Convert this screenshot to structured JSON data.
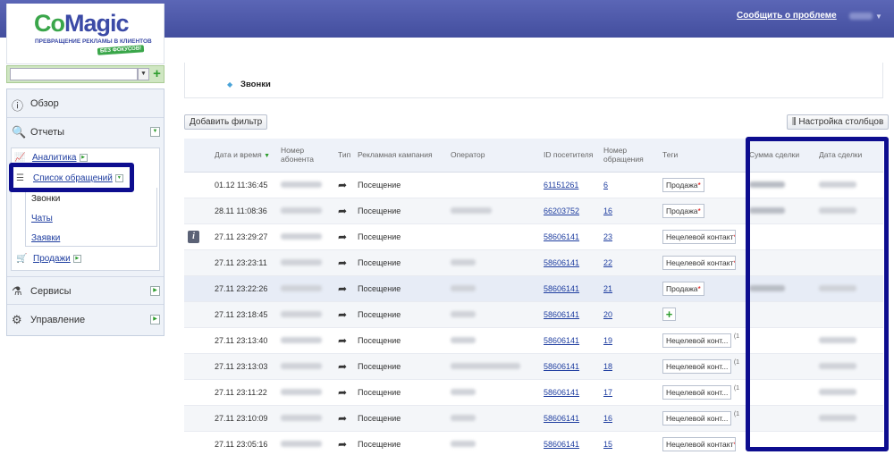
{
  "header": {
    "report_link": "Сообщить о проблеме"
  },
  "logo": {
    "word_a": "Co",
    "word_b": "Magic",
    "tagline": "ПРЕВРАЩЕНИЕ РЕКЛАМЫ В КЛИЕНТОВ",
    "badge": "БЕЗ ФОКУСОВ!"
  },
  "search": {
    "value": ""
  },
  "sidebar": {
    "overview": "Обзор",
    "reports": "Отчеты",
    "analytics": "Аналитика",
    "calls_list": "Список обращений",
    "calls": "Звонки",
    "chats": "Чаты",
    "requests": "Заявки",
    "sales": "Продажи",
    "services": "Сервисы",
    "management": "Управление"
  },
  "breadcrumb": {
    "current": "Звонки"
  },
  "toolbar": {
    "add_filter": "Добавить фильтр",
    "columns": "Настройка столбцов"
  },
  "table": {
    "headers": {
      "datetime": "Дата и время",
      "number": "Номер абонента",
      "type": "Тип",
      "campaign": "Рекламная кампания",
      "operator": "Оператор",
      "visitor": "ID посетителя",
      "request_no": "Номер обращения",
      "tags": "Теги",
      "deal_sum": "Сумма сделки",
      "deal_date": "Дата сделки"
    },
    "rows": [
      {
        "datetime": "01.12 11:36:45",
        "campaign": "Посещение",
        "visitor": "61151261",
        "request_no": "6",
        "tag": "Продажа",
        "tag_star": true,
        "tag_extra": "",
        "operator": false,
        "deal_sum": true,
        "deal_date": true,
        "info": false,
        "selected": false
      },
      {
        "datetime": "28.11 11:08:36",
        "campaign": "Посещение",
        "visitor": "66203752",
        "request_no": "16",
        "tag": "Продажа",
        "tag_star": true,
        "tag_extra": "",
        "operator": true,
        "deal_sum": true,
        "deal_date": true,
        "info": false,
        "selected": false
      },
      {
        "datetime": "27.11 23:29:27",
        "campaign": "Посещение",
        "visitor": "58606141",
        "request_no": "23",
        "tag": "Нецелевой контакт",
        "tag_star": true,
        "tag_extra": "",
        "operator": false,
        "deal_sum": false,
        "deal_date": false,
        "info": true,
        "selected": false
      },
      {
        "datetime": "27.11 23:23:11",
        "campaign": "Посещение",
        "visitor": "58606141",
        "request_no": "22",
        "tag": "Нецелевой контакт",
        "tag_star": true,
        "tag_extra": "",
        "operator": true,
        "deal_sum": false,
        "deal_date": false,
        "info": false,
        "selected": false
      },
      {
        "datetime": "27.11 23:22:26",
        "campaign": "Посещение",
        "visitor": "58606141",
        "request_no": "21",
        "tag": "Продажа",
        "tag_star": true,
        "tag_extra": "",
        "operator": true,
        "deal_sum": true,
        "deal_date": true,
        "info": false,
        "selected": true
      },
      {
        "datetime": "27.11 23:18:45",
        "campaign": "Посещение",
        "visitor": "58606141",
        "request_no": "20",
        "tag": "",
        "tag_star": false,
        "tag_extra": "",
        "operator": true,
        "deal_sum": false,
        "deal_date": false,
        "info": false,
        "selected": false
      },
      {
        "datetime": "27.11 23:13:40",
        "campaign": "Посещение",
        "visitor": "58606141",
        "request_no": "19",
        "tag": "Нецелевой конт...",
        "tag_star": false,
        "tag_extra": "(1",
        "operator": true,
        "deal_sum": false,
        "deal_date": true,
        "info": false,
        "selected": false
      },
      {
        "datetime": "27.11 23:13:03",
        "campaign": "Посещение",
        "visitor": "58606141",
        "request_no": "18",
        "tag": "Нецелевой конт...",
        "tag_star": false,
        "tag_extra": "(1",
        "operator": true,
        "deal_sum": false,
        "deal_date": true,
        "info": false,
        "selected": false
      },
      {
        "datetime": "27.11 23:11:22",
        "campaign": "Посещение",
        "visitor": "58606141",
        "request_no": "17",
        "tag": "Нецелевой конт...",
        "tag_star": false,
        "tag_extra": "(1",
        "operator": true,
        "deal_sum": false,
        "deal_date": true,
        "info": false,
        "selected": false
      },
      {
        "datetime": "27.11 23:10:09",
        "campaign": "Посещение",
        "visitor": "58606141",
        "request_no": "16",
        "tag": "Нецелевой конт...",
        "tag_star": false,
        "tag_extra": "(1",
        "operator": true,
        "deal_sum": false,
        "deal_date": true,
        "info": false,
        "selected": false
      },
      {
        "datetime": "27.11 23:05:16",
        "campaign": "Посещение",
        "visitor": "58606141",
        "request_no": "15",
        "tag": "Нецелевой контакт",
        "tag_star": true,
        "tag_extra": "",
        "operator": true,
        "deal_sum": false,
        "deal_date": false,
        "info": false,
        "selected": false
      }
    ]
  },
  "colors": {
    "header": "#4f5aa9",
    "logo_green": "#3aa64a",
    "logo_blue": "#3b4aa6",
    "link": "#1f3ea0",
    "highlight": "#0d0d8f"
  }
}
